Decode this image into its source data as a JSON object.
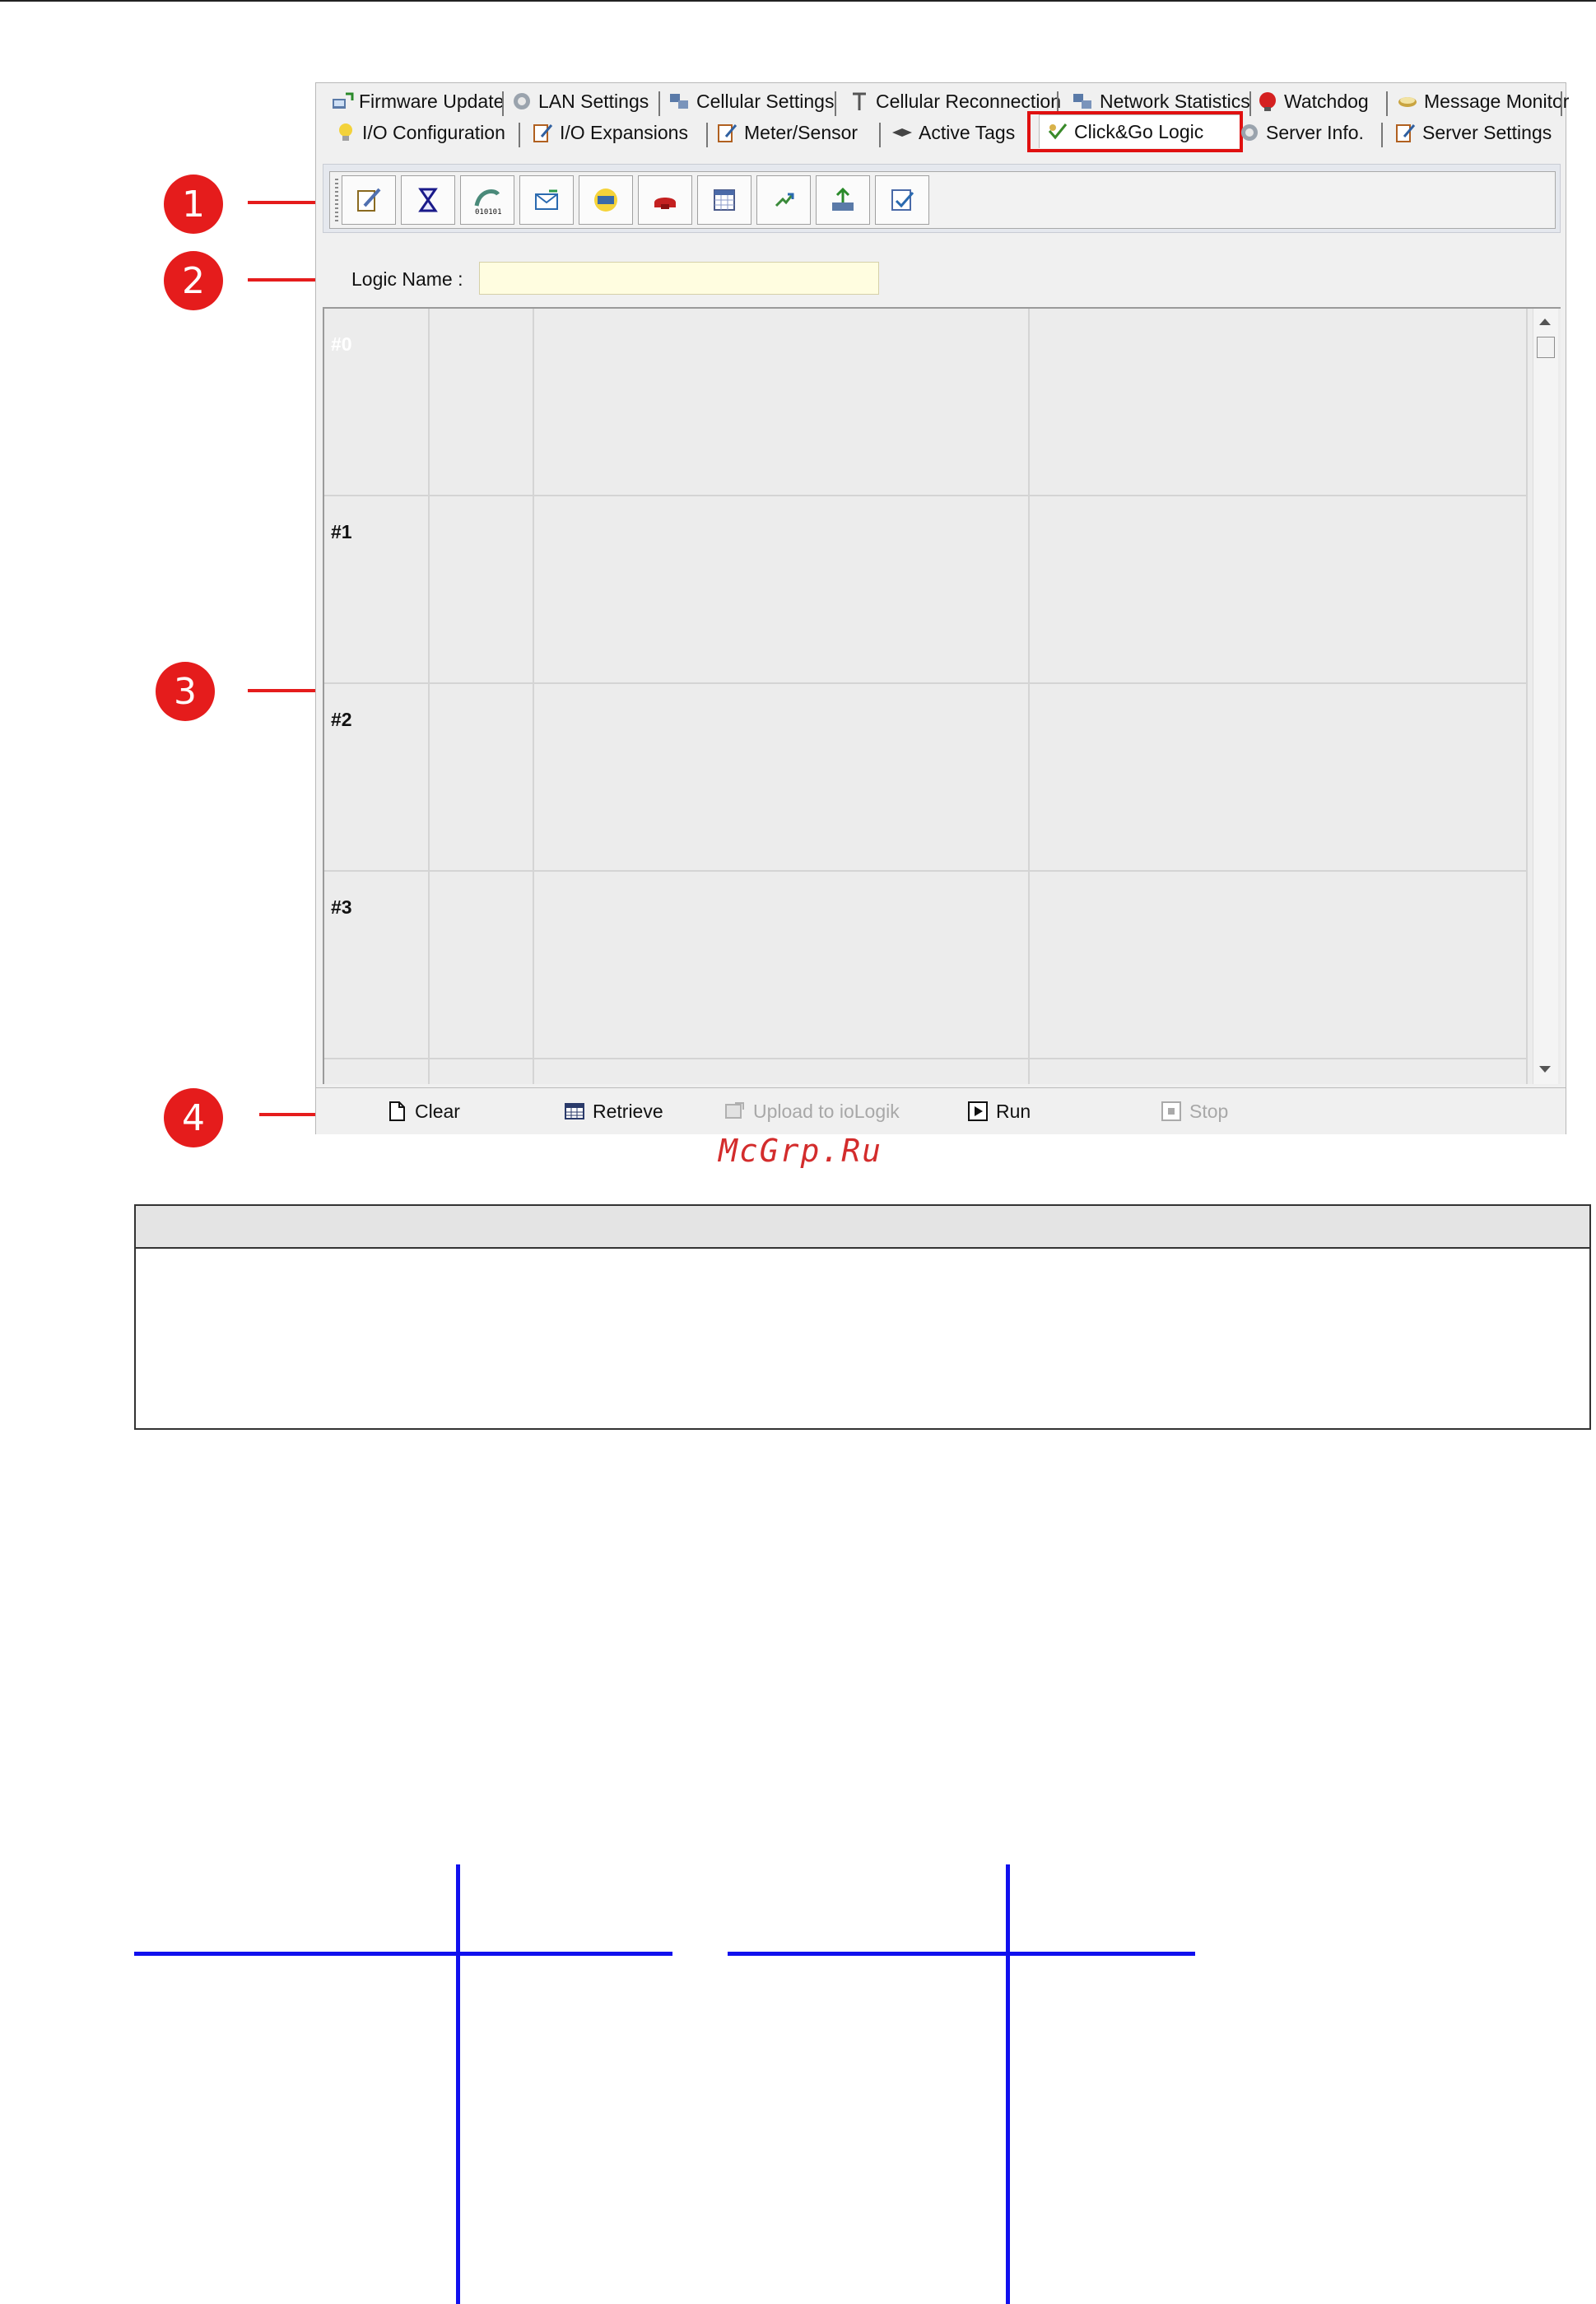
{
  "tabs": {
    "row1": [
      {
        "label": "Firmware Update",
        "icon": "firmware-icon"
      },
      {
        "label": "LAN Settings",
        "icon": "lan-icon"
      },
      {
        "label": "Cellular Settings",
        "icon": "cellular-icon"
      },
      {
        "label": "Cellular Reconnection",
        "icon": "antenna-icon"
      },
      {
        "label": "Network Statistics",
        "icon": "network-icon"
      },
      {
        "label": "Watchdog",
        "icon": "watchdog-icon"
      },
      {
        "label": "Message Monitor",
        "icon": "message-icon"
      }
    ],
    "row2": [
      {
        "label": "I/O Configuration",
        "icon": "bulb-icon"
      },
      {
        "label": "I/O Expansions",
        "icon": "edit-icon"
      },
      {
        "label": "Meter/Sensor",
        "icon": "edit-icon"
      },
      {
        "label": "Active Tags",
        "icon": "tags-icon"
      },
      {
        "label": "Click&Go Logic",
        "icon": "logic-icon",
        "selected": true
      },
      {
        "label": "Server Info.",
        "icon": "server-icon"
      },
      {
        "label": "Server Settings",
        "icon": "edit-icon"
      }
    ]
  },
  "toolbar": {
    "buttons": [
      "edit-icon",
      "hourglass-icon",
      "binary-icon",
      "email-icon",
      "chip-icon",
      "phone-icon",
      "calendar-icon",
      "refresh-icon",
      "upload-icon",
      "check-icon"
    ]
  },
  "logic": {
    "label": "Logic Name :",
    "value": ""
  },
  "grid": {
    "rows": [
      "#0",
      "#1",
      "#2",
      "#3"
    ]
  },
  "bottom": {
    "clear": "Clear",
    "retrieve": "Retrieve",
    "upload": "Upload to ioLogik",
    "run": "Run",
    "stop": "Stop"
  },
  "callouts": [
    "1",
    "2",
    "3",
    "4"
  ],
  "watermark": "McGrp.Ru",
  "colors": {
    "callout": "#e51c1c",
    "highlight": "#e01010",
    "input_bg": "#fffde0",
    "blue_lines": "#1010ee"
  }
}
